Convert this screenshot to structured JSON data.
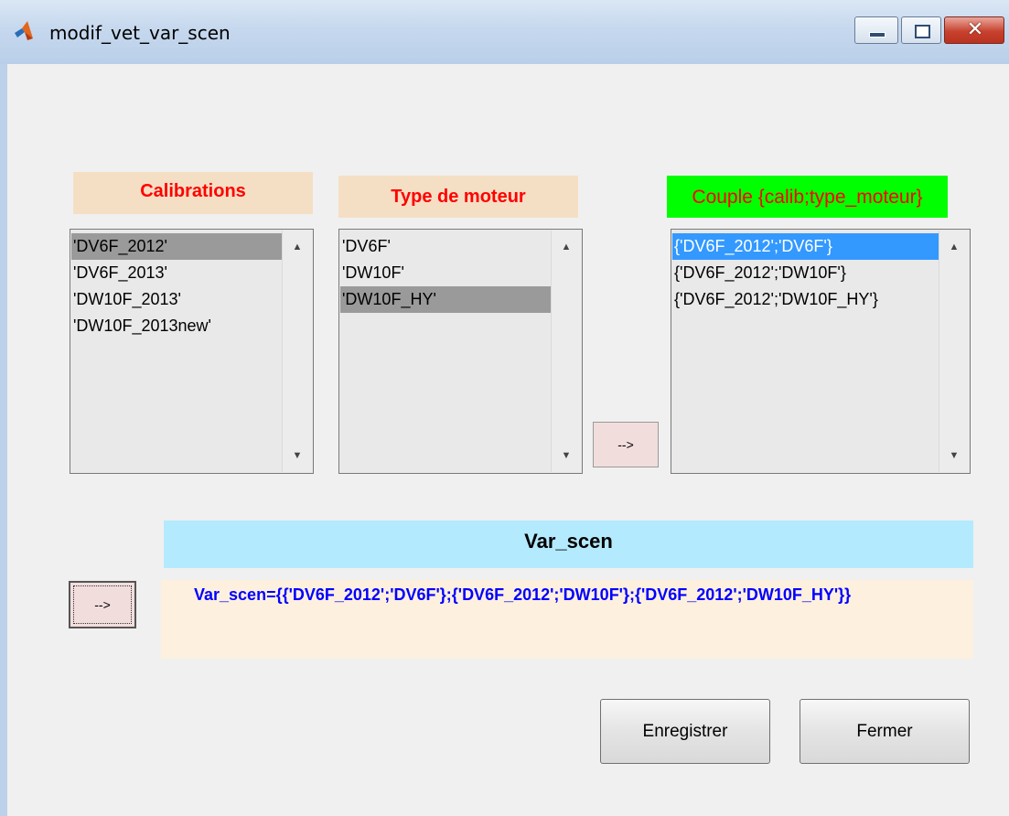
{
  "window": {
    "title": "modif_vet_var_scen",
    "controls": {
      "minimize": "minimize",
      "maximize": "maximize",
      "close": "✕"
    }
  },
  "labels": {
    "calibrations": "Calibrations",
    "type_moteur": "Type de moteur",
    "couple": "Couple {calib;type_moteur}"
  },
  "lists": {
    "calibrations": {
      "items": [
        "'DV6F_2012'",
        "'DV6F_2013'",
        "'DW10F_2013'",
        "'DW10F_2013new'"
      ],
      "selected_index": 0
    },
    "type_moteur": {
      "items": [
        "'DV6F'",
        "'DW10F'",
        "'DW10F_HY'"
      ],
      "selected_index": 2
    },
    "couple": {
      "items": [
        "{'DV6F_2012';'DV6F'}",
        "{'DV6F_2012';'DW10F'}",
        "{'DV6F_2012';'DW10F_HY'}"
      ],
      "selected_index": 0
    }
  },
  "buttons": {
    "add_couple": "-->",
    "build_var_scen": "-->",
    "save": "Enregistrer",
    "close": "Fermer"
  },
  "var_scen": {
    "title": "Var_scen",
    "value": "Var_scen={{'DV6F_2012';'DV6F'};{'DV6F_2012';'DW10F'};{'DV6F_2012';'DW10F_HY'}}"
  },
  "colors": {
    "label_bg": "#f5dfc4",
    "label_text": "#ff0000",
    "couple_label_bg": "#00ff00",
    "var_scen_title_bg": "#b3eafe",
    "var_scen_value_bg": "#fdf0df",
    "var_scen_value_text": "#0000ff",
    "selection_gray": "#9a9a9a",
    "selection_blue": "#3399ff"
  }
}
